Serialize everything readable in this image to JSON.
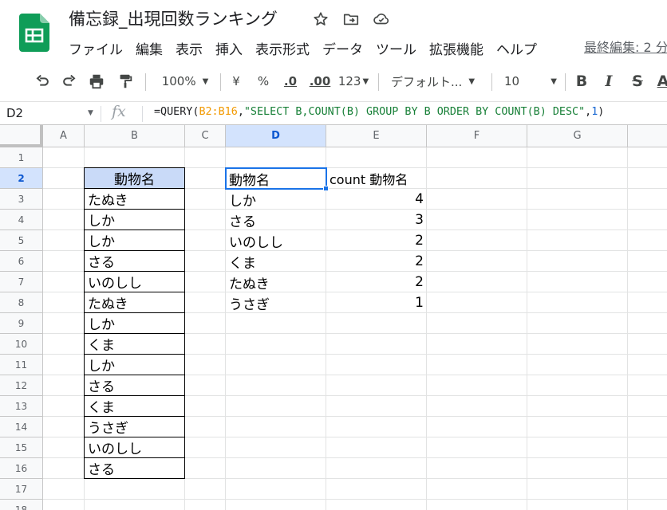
{
  "doc": {
    "title": "備忘録_出現回数ランキング",
    "last_edit": "最終編集: 2 分"
  },
  "menu": [
    "ファイル",
    "編集",
    "表示",
    "挿入",
    "表示形式",
    "データ",
    "ツール",
    "拡張機能",
    "ヘルプ"
  ],
  "toolbar": {
    "zoom": "100%",
    "currency": "¥",
    "percent": "%",
    "dec_decrease": ".0",
    "dec_increase": ".00",
    "number_format": "123",
    "font": "デフォルト...",
    "font_size": "10",
    "bold": "B",
    "italic": "I",
    "strike": "S",
    "text_color": "A"
  },
  "formula_bar": {
    "cell_ref": "D2",
    "fx": "fx",
    "formula_prefix": "=QUERY(",
    "formula_range": "B2:B16",
    "formula_comma1": ",",
    "formula_string": "\"SELECT B,COUNT(B) GROUP BY B ORDER BY COUNT(B) DESC\"",
    "formula_comma2": ",",
    "formula_number": "1",
    "formula_suffix": ")"
  },
  "columns": [
    "A",
    "B",
    "C",
    "D",
    "E",
    "F",
    "G"
  ],
  "rows": [
    "1",
    "2",
    "3",
    "4",
    "5",
    "6",
    "7",
    "8",
    "9",
    "10",
    "11",
    "12",
    "13",
    "14",
    "15",
    "16",
    "17",
    "18"
  ],
  "column_b": [
    "動物名",
    "たぬき",
    "しか",
    "しか",
    "さる",
    "いのしし",
    "たぬき",
    "しか",
    "くま",
    "しか",
    "さる",
    "くま",
    "うさぎ",
    "いのしし",
    "さる"
  ],
  "query_header": {
    "d": "動物名",
    "e": "count 動物名"
  },
  "query_results": [
    {
      "animal": "しか",
      "count": "4"
    },
    {
      "animal": "さる",
      "count": "3"
    },
    {
      "animal": "いのしし",
      "count": "2"
    },
    {
      "animal": "くま",
      "count": "2"
    },
    {
      "animal": "たぬき",
      "count": "2"
    },
    {
      "animal": "うさぎ",
      "count": "1"
    }
  ],
  "selected_cell": "D2",
  "colors": {
    "accent": "#1a73e8",
    "header_fill": "#c9daf8",
    "logo": "#0f9d58",
    "range": "#f29900",
    "string": "#188038"
  }
}
